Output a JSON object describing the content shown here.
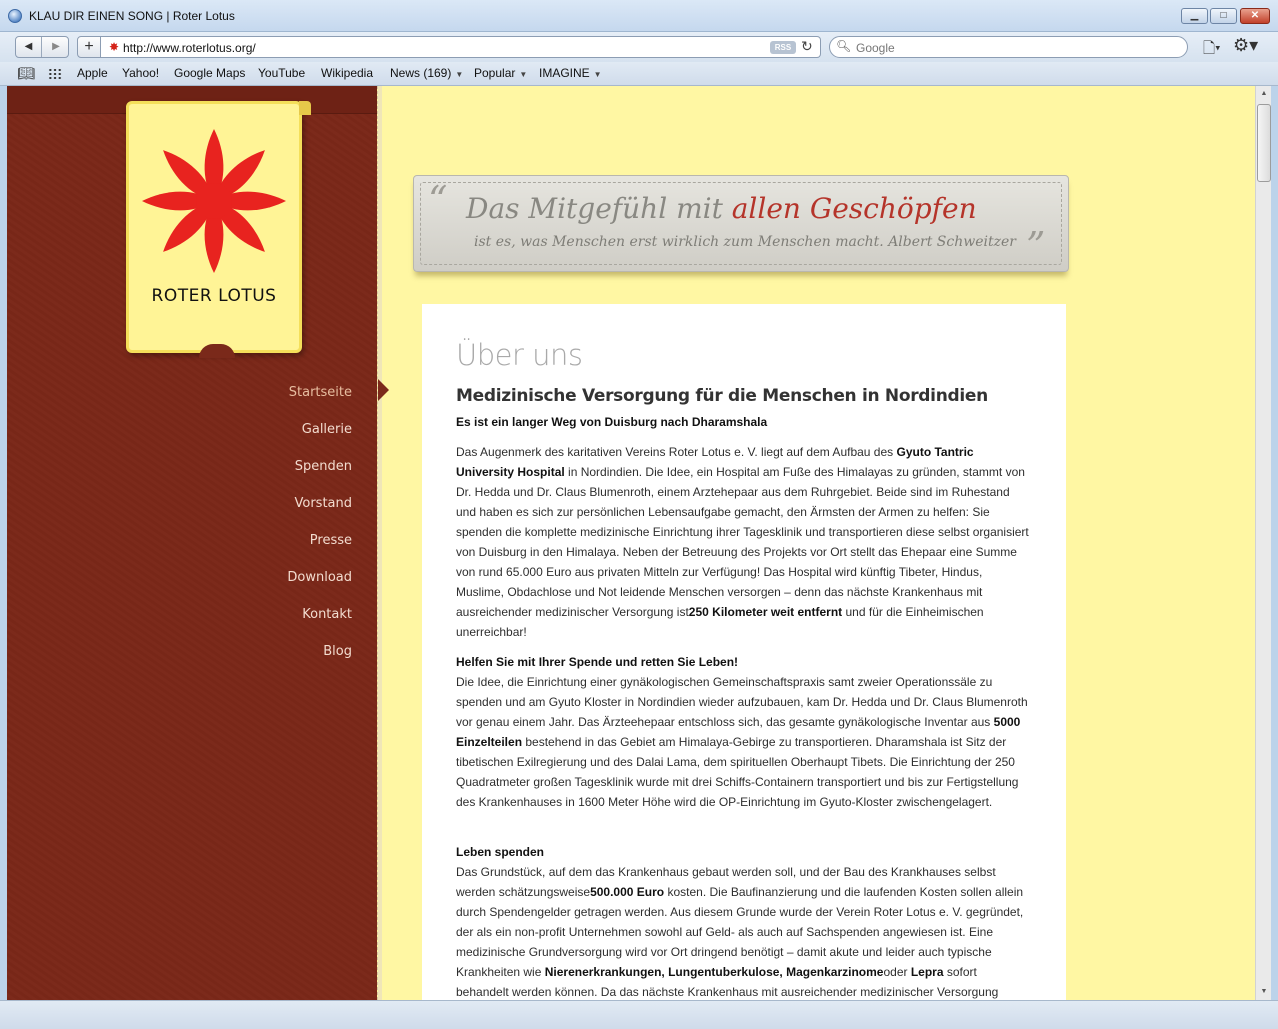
{
  "window": {
    "title": "KLAU DIR EINEN SONG | Roter Lotus",
    "controls": {
      "minimize": "▁",
      "maximize": "□",
      "close": "✕"
    }
  },
  "toolbar": {
    "back": "◀",
    "forward": "▶",
    "add": "+",
    "url": "http://www.roterlotus.org/",
    "rss_label": "RSS",
    "search_placeholder": "Google"
  },
  "bookmarks": {
    "items": [
      {
        "label": "Apple"
      },
      {
        "label": "Yahoo!"
      },
      {
        "label": "Google Maps"
      },
      {
        "label": "YouTube"
      },
      {
        "label": "Wikipedia"
      },
      {
        "label": "News (169)",
        "menu": true
      },
      {
        "label": "Popular",
        "menu": true
      },
      {
        "label": "IMAGINE",
        "menu": true
      }
    ]
  },
  "site": {
    "logo_text": "ROTER LOTUS",
    "nav": [
      {
        "label": "Startseite",
        "active": true
      },
      {
        "label": "Gallerie"
      },
      {
        "label": "Spenden"
      },
      {
        "label": "Vorstand"
      },
      {
        "label": "Presse"
      },
      {
        "label": "Download"
      },
      {
        "label": "Kontakt"
      },
      {
        "label": "Blog"
      }
    ],
    "quote": {
      "line1_part1": "Das Mitgefühl mit ",
      "line1_accent": "allen Geschöpfen",
      "line2": "ist es, was Menschen erst wirklich zum Menschen macht. Albert Schweitzer"
    },
    "colors": {
      "sidebar": "#7a291a",
      "background": "#fff7a3",
      "accent": "#b5342a",
      "logo_card": "#fff496",
      "flower": "#e8231f"
    }
  },
  "content": {
    "title": "Über uns",
    "subtitle": "Medizinische Versorgung für die Menschen in Nordindien",
    "lead": "Es ist ein langer Weg von Duisburg nach Dharamshala",
    "p1": [
      "Das Augenmerk des karitativen Vereins Roter Lotus e. V. liegt auf dem Aufbau des ",
      "Gyuto Tantric University Hospital",
      " in Nordindien. Die Idee, ein Hospital am Fuße des Himalayas zu gründen, stammt von Dr. Hedda und Dr. Claus Blumenroth, einem Arztehepaar aus dem Ruhrgebiet. Beide sind im Ruhestand und haben es sich zur persönlichen Lebensaufgabe gemacht, den Ärmsten der Armen zu helfen: Sie spenden die komplette medizinische Einrichtung ihrer Tagesklinik und transportieren diese selbst organisiert von Duisburg in den Himalaya. Neben der Betreuung des Projekts vor Ort stellt das Ehepaar eine Summe von rund 65.000 Euro aus privaten Mitteln zur Verfügung! Das Hospital wird künftig Tibeter, Hindus, Muslime, Obdachlose und Not leidende Menschen versorgen – denn das nächste Krankenhaus mit ausreichender medizinischer Versorgung ist",
      "250 Kilometer weit entfernt",
      " und für die Einheimischen unerreichbar!"
    ],
    "p2_heading": "Helfen Sie mit Ihrer Spende und retten Sie Leben!",
    "p2": [
      "Die Idee, die Einrichtung einer gynäkologischen Gemeinschaftspraxis samt zweier Operationssäle zu spenden und am Gyuto Kloster in Nordindien wieder aufzubauen, kam Dr. Hedda und Dr. Claus Blumenroth vor genau einem Jahr. Das Ärzteehepaar entschloss sich, das gesamte gynäkologische Inventar aus ",
      "5000 Einzelteilen",
      " bestehend in das Gebiet am Himalaya-Gebirge zu transportieren. Dharamshala ist Sitz der tibetischen Exilregierung und des Dalai Lama, dem spirituellen Oberhaupt Tibets. Die Einrichtung der 250 Quadratmeter großen Tagesklinik wurde mit drei Schiffs-Containern transportiert und bis zur Fertigstellung des Krankenhauses in 1600 Meter Höhe wird die OP-Einrichtung im Gyuto-Kloster zwischengelagert."
    ],
    "p3_heading": "Leben spenden",
    "p3": [
      "Das Grundstück, auf dem das Krankenhaus gebaut werden soll, und der Bau des Krankhauses selbst werden schätzungsweise",
      "500.000 Euro",
      " kosten. Die Baufinanzierung und die laufenden Kosten sollen allein durch Spendengelder getragen werden. Aus diesem Grunde wurde der Verein Roter Lotus e. V. gegründet, der als ein non-profit Unternehmen sowohl auf Geld- als auch auf Sachspenden angewiesen ist. Eine medizinische Grundversorgung wird vor Ort dringend benötigt – damit akute und leider auch typische Krankheiten wie ",
      "Nierenerkrankungen, Lungentuberkulose, Magenkarzinome",
      "oder ",
      "Lepra",
      " sofort behandelt werden können. Da das nächste Krankenhaus mit ausreichender medizinischer Versorgung"
    ]
  }
}
